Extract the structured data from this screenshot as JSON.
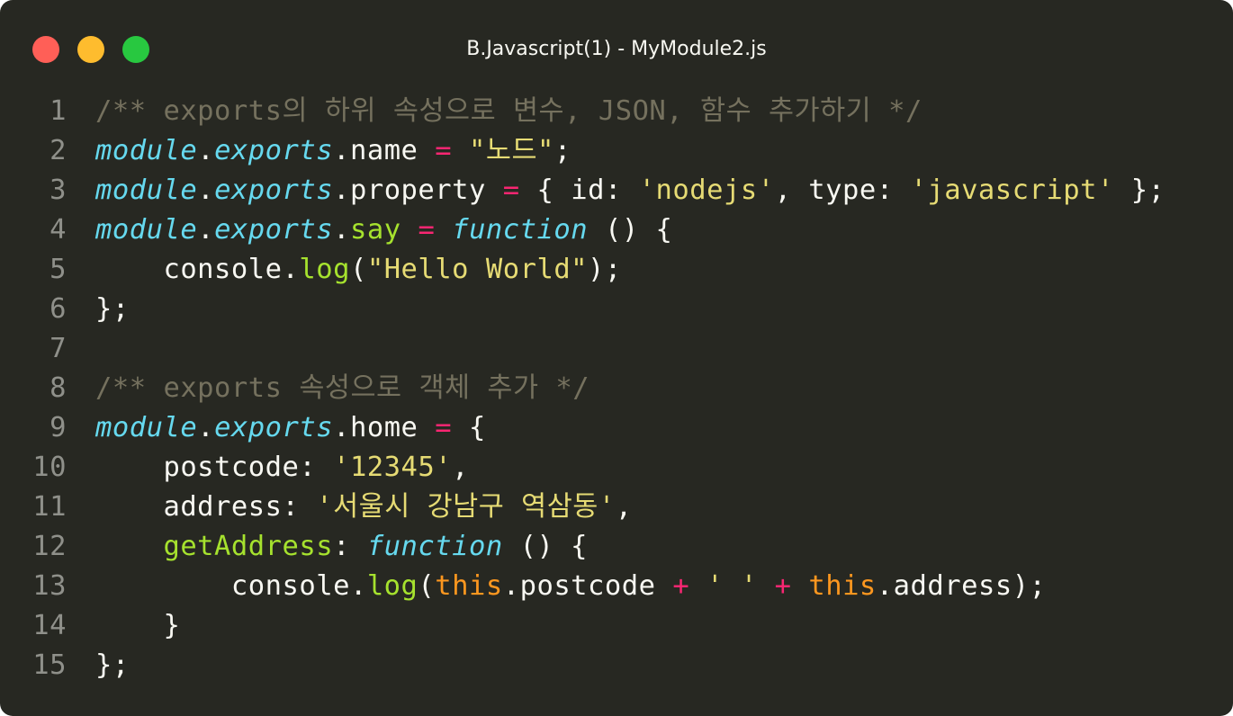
{
  "window": {
    "title": "B.Javascript(1) - MyModule2.js",
    "controls": {
      "close_icon": "red-circle",
      "minimize_icon": "yellow-circle",
      "maximize_icon": "green-circle"
    }
  },
  "colors": {
    "background": "#272822",
    "comment": "#75715e",
    "keyword": "#66d9ef",
    "operator": "#f92672",
    "string": "#e6db74",
    "function": "#a6e22e",
    "this": "#fd971f",
    "plain": "#f8f8f2",
    "line_number": "#8f908a"
  },
  "code": {
    "lines": [
      {
        "number": "1",
        "tokens": [
          {
            "t": "/** exports의 하위 속성으로 변수, JSON, 함수 추가하기 */",
            "c": "t-comment"
          }
        ]
      },
      {
        "number": "2",
        "tokens": [
          {
            "t": "module",
            "c": "t-keyword-it"
          },
          {
            "t": ".",
            "c": "t-plain"
          },
          {
            "t": "exports",
            "c": "t-keyword-it"
          },
          {
            "t": ".name ",
            "c": "t-plain"
          },
          {
            "t": "=",
            "c": "t-op"
          },
          {
            "t": " ",
            "c": "t-plain"
          },
          {
            "t": "\"노드\"",
            "c": "t-string"
          },
          {
            "t": ";",
            "c": "t-plain"
          }
        ]
      },
      {
        "number": "3",
        "tokens": [
          {
            "t": "module",
            "c": "t-keyword-it"
          },
          {
            "t": ".",
            "c": "t-plain"
          },
          {
            "t": "exports",
            "c": "t-keyword-it"
          },
          {
            "t": ".property ",
            "c": "t-plain"
          },
          {
            "t": "=",
            "c": "t-op"
          },
          {
            "t": " { id: ",
            "c": "t-plain"
          },
          {
            "t": "'nodejs'",
            "c": "t-string"
          },
          {
            "t": ", type: ",
            "c": "t-plain"
          },
          {
            "t": "'javascript'",
            "c": "t-string"
          },
          {
            "t": " };",
            "c": "t-plain"
          }
        ]
      },
      {
        "number": "4",
        "tokens": [
          {
            "t": "module",
            "c": "t-keyword-it"
          },
          {
            "t": ".",
            "c": "t-plain"
          },
          {
            "t": "exports",
            "c": "t-keyword-it"
          },
          {
            "t": ".",
            "c": "t-plain"
          },
          {
            "t": "say",
            "c": "t-func"
          },
          {
            "t": " ",
            "c": "t-plain"
          },
          {
            "t": "=",
            "c": "t-op"
          },
          {
            "t": " ",
            "c": "t-plain"
          },
          {
            "t": "function",
            "c": "t-keyword-it"
          },
          {
            "t": " () {",
            "c": "t-plain"
          }
        ]
      },
      {
        "number": "5",
        "tokens": [
          {
            "t": "    console.",
            "c": "t-plain"
          },
          {
            "t": "log",
            "c": "t-func"
          },
          {
            "t": "(",
            "c": "t-plain"
          },
          {
            "t": "\"Hello World\"",
            "c": "t-string"
          },
          {
            "t": ");",
            "c": "t-plain"
          }
        ]
      },
      {
        "number": "6",
        "tokens": [
          {
            "t": "};",
            "c": "t-plain"
          }
        ]
      },
      {
        "number": "7",
        "tokens": []
      },
      {
        "number": "8",
        "tokens": [
          {
            "t": "/** exports 속성으로 객체 추가 */",
            "c": "t-comment"
          }
        ]
      },
      {
        "number": "9",
        "tokens": [
          {
            "t": "module",
            "c": "t-keyword-it"
          },
          {
            "t": ".",
            "c": "t-plain"
          },
          {
            "t": "exports",
            "c": "t-keyword-it"
          },
          {
            "t": ".home ",
            "c": "t-plain"
          },
          {
            "t": "=",
            "c": "t-op"
          },
          {
            "t": " {",
            "c": "t-plain"
          }
        ]
      },
      {
        "number": "10",
        "tokens": [
          {
            "t": "    postcode: ",
            "c": "t-plain"
          },
          {
            "t": "'12345'",
            "c": "t-string"
          },
          {
            "t": ",",
            "c": "t-plain"
          }
        ]
      },
      {
        "number": "11",
        "tokens": [
          {
            "t": "    address: ",
            "c": "t-plain"
          },
          {
            "t": "'서울시 강남구 역삼동'",
            "c": "t-string"
          },
          {
            "t": ",",
            "c": "t-plain"
          }
        ]
      },
      {
        "number": "12",
        "tokens": [
          {
            "t": "    ",
            "c": "t-plain"
          },
          {
            "t": "getAddress",
            "c": "t-func"
          },
          {
            "t": ": ",
            "c": "t-plain"
          },
          {
            "t": "function",
            "c": "t-keyword-it"
          },
          {
            "t": " () {",
            "c": "t-plain"
          }
        ]
      },
      {
        "number": "13",
        "tokens": [
          {
            "t": "        console.",
            "c": "t-plain"
          },
          {
            "t": "log",
            "c": "t-func"
          },
          {
            "t": "(",
            "c": "t-plain"
          },
          {
            "t": "this",
            "c": "t-this"
          },
          {
            "t": ".postcode ",
            "c": "t-plain"
          },
          {
            "t": "+",
            "c": "t-op"
          },
          {
            "t": " ",
            "c": "t-plain"
          },
          {
            "t": "' '",
            "c": "t-string"
          },
          {
            "t": " ",
            "c": "t-plain"
          },
          {
            "t": "+",
            "c": "t-op"
          },
          {
            "t": " ",
            "c": "t-plain"
          },
          {
            "t": "this",
            "c": "t-this"
          },
          {
            "t": ".address);",
            "c": "t-plain"
          }
        ]
      },
      {
        "number": "14",
        "tokens": [
          {
            "t": "    }",
            "c": "t-plain"
          }
        ]
      },
      {
        "number": "15",
        "tokens": [
          {
            "t": "};",
            "c": "t-plain"
          }
        ]
      }
    ]
  }
}
